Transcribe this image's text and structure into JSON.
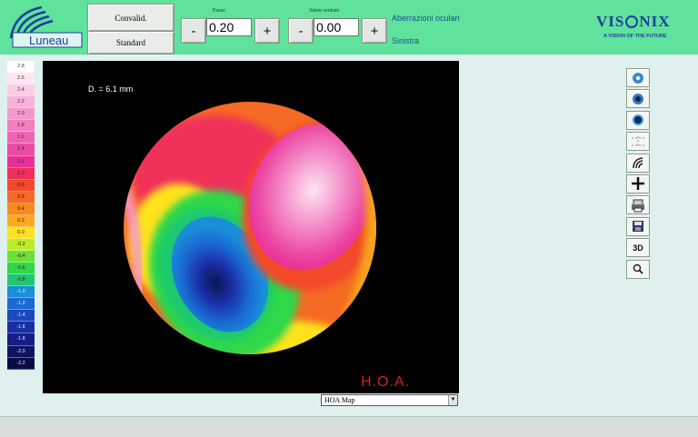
{
  "header": {
    "logo_text": "Luneau",
    "convalid_label": "Convalid.",
    "standard_label": "Standard",
    "step": {
      "label": "Passo",
      "value": "0.20",
      "minus": "-",
      "plus": "+"
    },
    "central_value": {
      "label": "Valore centrale",
      "value": "0.00",
      "minus": "-",
      "plus": "+"
    },
    "title": "Aberrazioni oculari",
    "eye": "Sinistra",
    "brand": {
      "left": "VIS",
      "right": "NIX",
      "tagline": "A VISION OF THE FUTURE"
    }
  },
  "scale": [
    {
      "label": "2.8",
      "color": "#ffffff"
    },
    {
      "label": "2.6",
      "color": "#fde6f2"
    },
    {
      "label": "2.4",
      "color": "#fbcde6"
    },
    {
      "label": "2.2",
      "color": "#f8b2d9"
    },
    {
      "label": "2.0",
      "color": "#f598cd"
    },
    {
      "label": "1.8",
      "color": "#f27ec0"
    },
    {
      "label": "1.6",
      "color": "#ef64b2"
    },
    {
      "label": "1.4",
      "color": "#ec4aa4"
    },
    {
      "label": "1.2",
      "color": "#e93096"
    },
    {
      "label": "1.0",
      "color": "#f0305a"
    },
    {
      "label": "0.8",
      "color": "#f24a2a"
    },
    {
      "label": "0.6",
      "color": "#f56a24"
    },
    {
      "label": "0.4",
      "color": "#f88a20"
    },
    {
      "label": "0.2",
      "color": "#fbaa1e"
    },
    {
      "label": "0.0",
      "color": "#fde21c"
    },
    {
      "label": "-0.2",
      "color": "#b8ee26"
    },
    {
      "label": "-0.4",
      "color": "#6ae236"
    },
    {
      "label": "-0.6",
      "color": "#2fd84a"
    },
    {
      "label": "-0.8",
      "color": "#1ec870"
    },
    {
      "label": "-1.0",
      "color": "#1890d8"
    },
    {
      "label": "-1.2",
      "color": "#1a6ad2"
    },
    {
      "label": "-1.4",
      "color": "#1c48c0"
    },
    {
      "label": "-1.6",
      "color": "#1a2ea6"
    },
    {
      "label": "-1.8",
      "color": "#141e86"
    },
    {
      "label": "-2.0",
      "color": "#0e1464"
    },
    {
      "label": "-2.2",
      "color": "#0a0c44"
    }
  ],
  "map": {
    "diameter_label": "D. = 6.1 mm",
    "type_label": "H.O.A."
  },
  "map_selector": {
    "value": "HOA Map",
    "arrow": "▼"
  },
  "tools": [
    {
      "name": "eye-small-icon",
      "glyph": ""
    },
    {
      "name": "eye-medium-icon",
      "glyph": ""
    },
    {
      "name": "eye-large-icon",
      "glyph": ""
    },
    {
      "name": "grid-icon",
      "glyph": ""
    },
    {
      "name": "wavefront-icon",
      "glyph": ""
    },
    {
      "name": "crosshair-icon",
      "glyph": ""
    },
    {
      "name": "print-icon",
      "glyph": ""
    },
    {
      "name": "save-icon",
      "glyph": ""
    },
    {
      "name": "view-3d-icon",
      "glyph": "3D"
    },
    {
      "name": "zoom-icon",
      "glyph": ""
    }
  ]
}
